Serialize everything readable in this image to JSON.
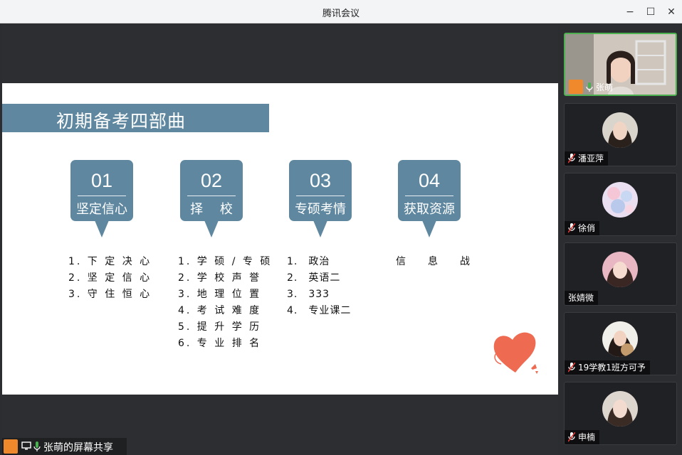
{
  "window": {
    "title": "腾讯会议",
    "controls": {
      "minimize": "−",
      "maximize": "☐",
      "close": "✕"
    }
  },
  "slide": {
    "title": "初期备考四部曲",
    "steps": [
      {
        "num": "01",
        "label": "坚定信心",
        "items": [
          "1. 下 定 决 心",
          "2. 坚 定 信 心",
          "3. 守 住 恒 心"
        ]
      },
      {
        "num": "02",
        "label": "择　 校",
        "items": [
          "1. 学 硕 / 专 硕",
          "2. 学 校 声 誉",
          "3. 地 理 位 置",
          "4. 考 试 难 度",
          "5. 提 升 学 历",
          "6. 专 业 排 名"
        ]
      },
      {
        "num": "03",
        "label": "专硕考情",
        "items": [
          "1.　政治",
          "2.　英语二",
          "3.　333",
          "4.　专业课二"
        ]
      },
      {
        "num": "04",
        "label": "获取资源",
        "items": [
          "信　　息　　战"
        ]
      }
    ]
  },
  "sharing": {
    "text": "张萌的屏幕共享"
  },
  "participants": [
    {
      "name": "张萌",
      "mic": "on",
      "host": true
    },
    {
      "name": "潘亚萍",
      "mic": "muted"
    },
    {
      "name": "徐俏",
      "mic": "muted"
    },
    {
      "name": "张婧微",
      "mic": "none"
    },
    {
      "name": "19学教1班方可予",
      "mic": "muted"
    },
    {
      "name": "申楠",
      "mic": "muted"
    }
  ],
  "colors": {
    "accent": "#5f88a0",
    "active_border": "#4caf50",
    "heart": "#ee6b52",
    "host_badge": "#f0892c"
  }
}
